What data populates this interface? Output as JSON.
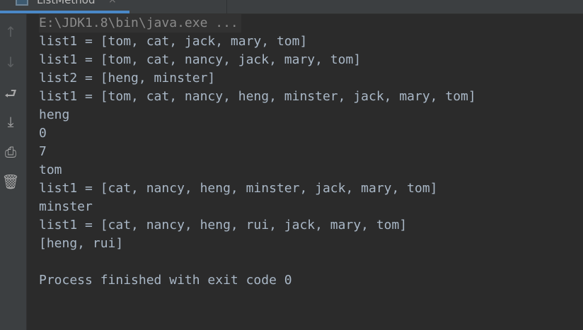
{
  "tab": {
    "label": "ListMethod",
    "close": "×"
  },
  "sidebar": {
    "icons": [
      "arrow-up-icon",
      "arrow-down-icon",
      "soft-wrap-icon",
      "scroll-to-end-icon",
      "print-icon",
      "trash-icon"
    ]
  },
  "console": {
    "command": "E:\\JDK1.8\\bin\\java.exe ...",
    "lines": [
      "list1 = [tom, cat, jack, mary, tom]",
      "list1 = [tom, cat, nancy, jack, mary, tom]",
      "list2 = [heng, minster]",
      "list1 = [tom, cat, nancy, heng, minster, jack, mary, tom]",
      "heng",
      "0",
      "7",
      "tom",
      "list1 = [cat, nancy, heng, minster, jack, mary, tom]",
      "minster",
      "list1 = [cat, nancy, heng, rui, jack, mary, tom]",
      "[heng, rui]",
      "",
      "Process finished with exit code 0"
    ]
  }
}
